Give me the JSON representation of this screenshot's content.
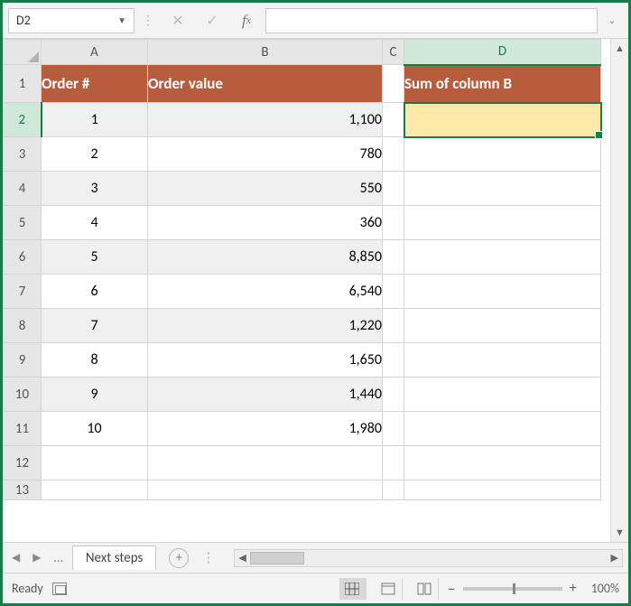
{
  "name_box": "D2",
  "formula_value": "",
  "columns": {
    "A": "A",
    "B": "B",
    "C": "C",
    "D": "D"
  },
  "headers": {
    "order_num": "Order #",
    "order_value": "Order value",
    "sum_col_b": "Sum of column B"
  },
  "rows": [
    {
      "num": "1",
      "order": "1",
      "value": "1,100"
    },
    {
      "num": "2",
      "order": "2",
      "value": "780"
    },
    {
      "num": "3",
      "order": "3",
      "value": "550"
    },
    {
      "num": "4",
      "order": "4",
      "value": "360"
    },
    {
      "num": "5",
      "order": "5",
      "value": "8,850"
    },
    {
      "num": "6",
      "order": "6",
      "value": "6,540"
    },
    {
      "num": "7",
      "order": "7",
      "value": "1,220"
    },
    {
      "num": "8",
      "order": "8",
      "value": "1,650"
    },
    {
      "num": "9",
      "order": "9",
      "value": "1,440"
    },
    {
      "num": "10",
      "order": "10",
      "value": "1,980"
    }
  ],
  "row_heads": [
    "1",
    "2",
    "3",
    "4",
    "5",
    "6",
    "7",
    "8",
    "9",
    "10",
    "11",
    "12",
    "13"
  ],
  "sheet_tab": "Next steps",
  "status": "Ready",
  "zoom": "100%",
  "selected_d2": ""
}
